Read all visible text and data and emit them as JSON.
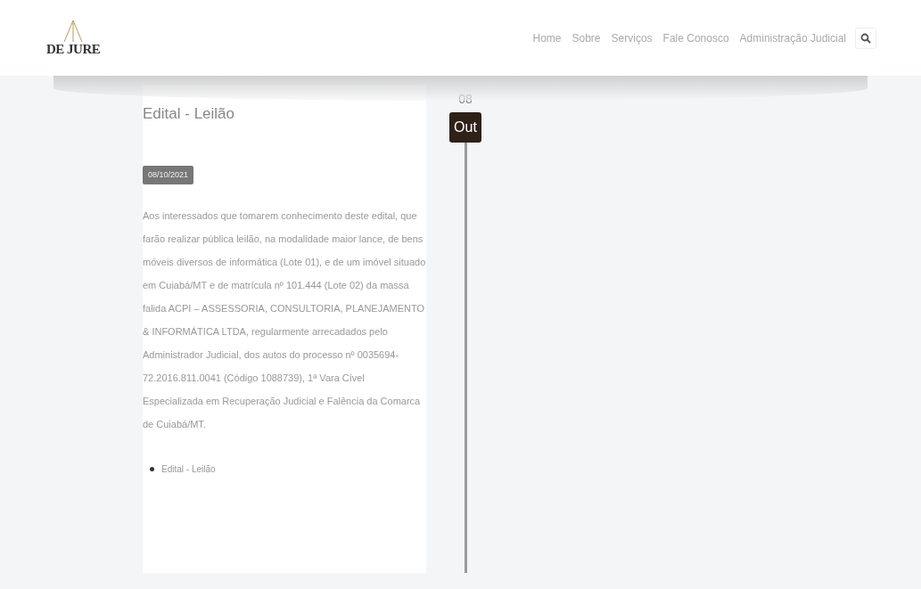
{
  "brand": {
    "name": "DE JURE"
  },
  "nav": {
    "items": [
      {
        "label": "Home"
      },
      {
        "label": "Sobre"
      },
      {
        "label": "Serviços"
      },
      {
        "label": "Fale Conosco"
      },
      {
        "label": "Administração Judicial"
      }
    ]
  },
  "post": {
    "title": "Edital - Leilão",
    "date_badge": "08/10/2021",
    "body": "Aos interessados que tomarem conhecimento deste edital, que farão realizar pública leilão, na modalidade maior lance, de bens móveis diversos de informática (Lote 01), e de um imóvel situado em Cuiabá/MT e de matrícula nº 101.444 (Lote 02) da massa falida ACPI – ASSESSORIA, CONSULTORIA, PLANEJAMENTO & INFORMÁTICA LTDA, regularmente arrecadados pelo Administrador Judicial, dos autos do processo nº 0035694-72.2016.811.0041 (Código 1088739), 1ª Vara Cível Especializada em Recuperação Judicial e Falência da Comarca de Cuiabá/MT.",
    "attachments": [
      {
        "label": "Edital - Leilão"
      }
    ]
  },
  "timeline": {
    "day": "08",
    "month": "Out"
  }
}
